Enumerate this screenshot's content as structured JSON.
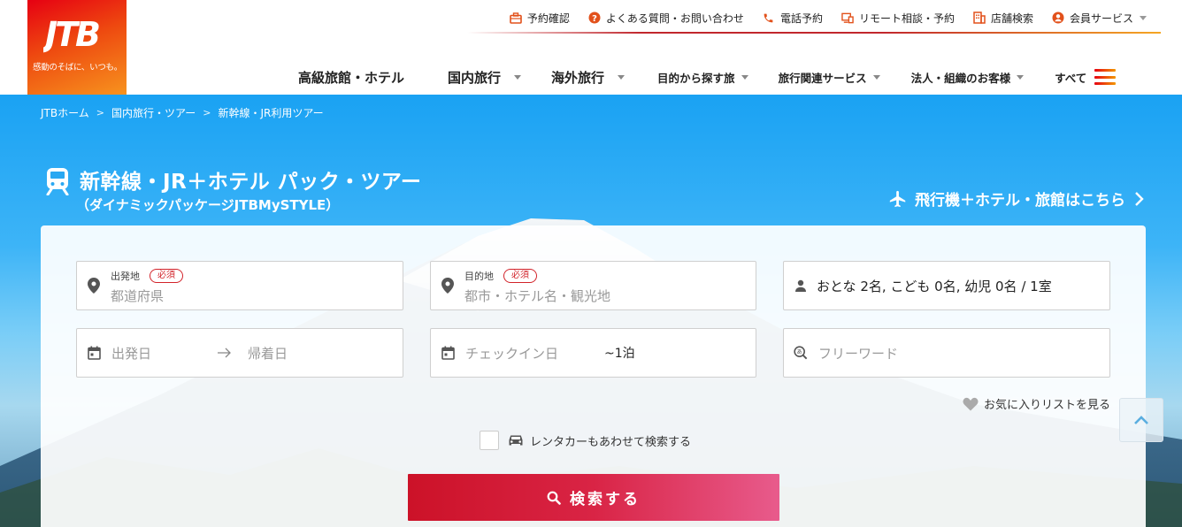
{
  "brand": {
    "logo_text": "JTB",
    "tagline": "感動のそばに、いつも。",
    "colors": {
      "red": "#e60012",
      "orange": "#f39800"
    }
  },
  "util_nav": [
    {
      "label": "予約確認",
      "icon": "briefcase-icon"
    },
    {
      "label": "よくある質問・お問い合わせ",
      "icon": "question-icon"
    },
    {
      "label": "電話予約",
      "icon": "phone-icon"
    },
    {
      "label": "リモート相談・予約",
      "icon": "remote-consult-icon"
    },
    {
      "label": "店舗検索",
      "icon": "store-icon"
    },
    {
      "label": "会員サービス",
      "icon": "user-circle-icon"
    }
  ],
  "main_nav": [
    {
      "label": "高級旅館・ホテル"
    },
    {
      "label": "国内旅行"
    },
    {
      "label": "海外旅行"
    },
    {
      "label": "目的から探す旅"
    },
    {
      "label": "旅行関連サービス"
    },
    {
      "label": "法人・組織のお客様"
    },
    {
      "label": "すべて"
    }
  ],
  "breadcrumb": [
    "JTBホーム",
    "国内旅行・ツアー",
    "新幹線・JR利用ツアー"
  ],
  "page": {
    "title": "新幹線・JR＋ホテル パック・ツアー",
    "subtitle": "（ダイナミックパッケージJTBMySTYLE）",
    "flight_link": "飛行機＋ホテル・旅館はこちら"
  },
  "search": {
    "origin": {
      "label": "出発地",
      "required": "必須",
      "placeholder": "都道府県"
    },
    "destination": {
      "label": "目的地",
      "required": "必須",
      "placeholder": "都市・ホテル名・観光地"
    },
    "travelers": {
      "value": "おとな 2名, こども 0名, 幼児 0名 / 1室"
    },
    "depart_date": {
      "placeholder": "出発日"
    },
    "return_date": {
      "placeholder": "帰着日"
    },
    "checkin": {
      "placeholder": "チェックイン日",
      "nights": "~1泊"
    },
    "keyword": {
      "placeholder": "フリーワード"
    },
    "favorites_link": "お気に入りリストを見る",
    "rental_car_label": "レンタカーもあわせて検索する",
    "submit_label": "検索する"
  }
}
